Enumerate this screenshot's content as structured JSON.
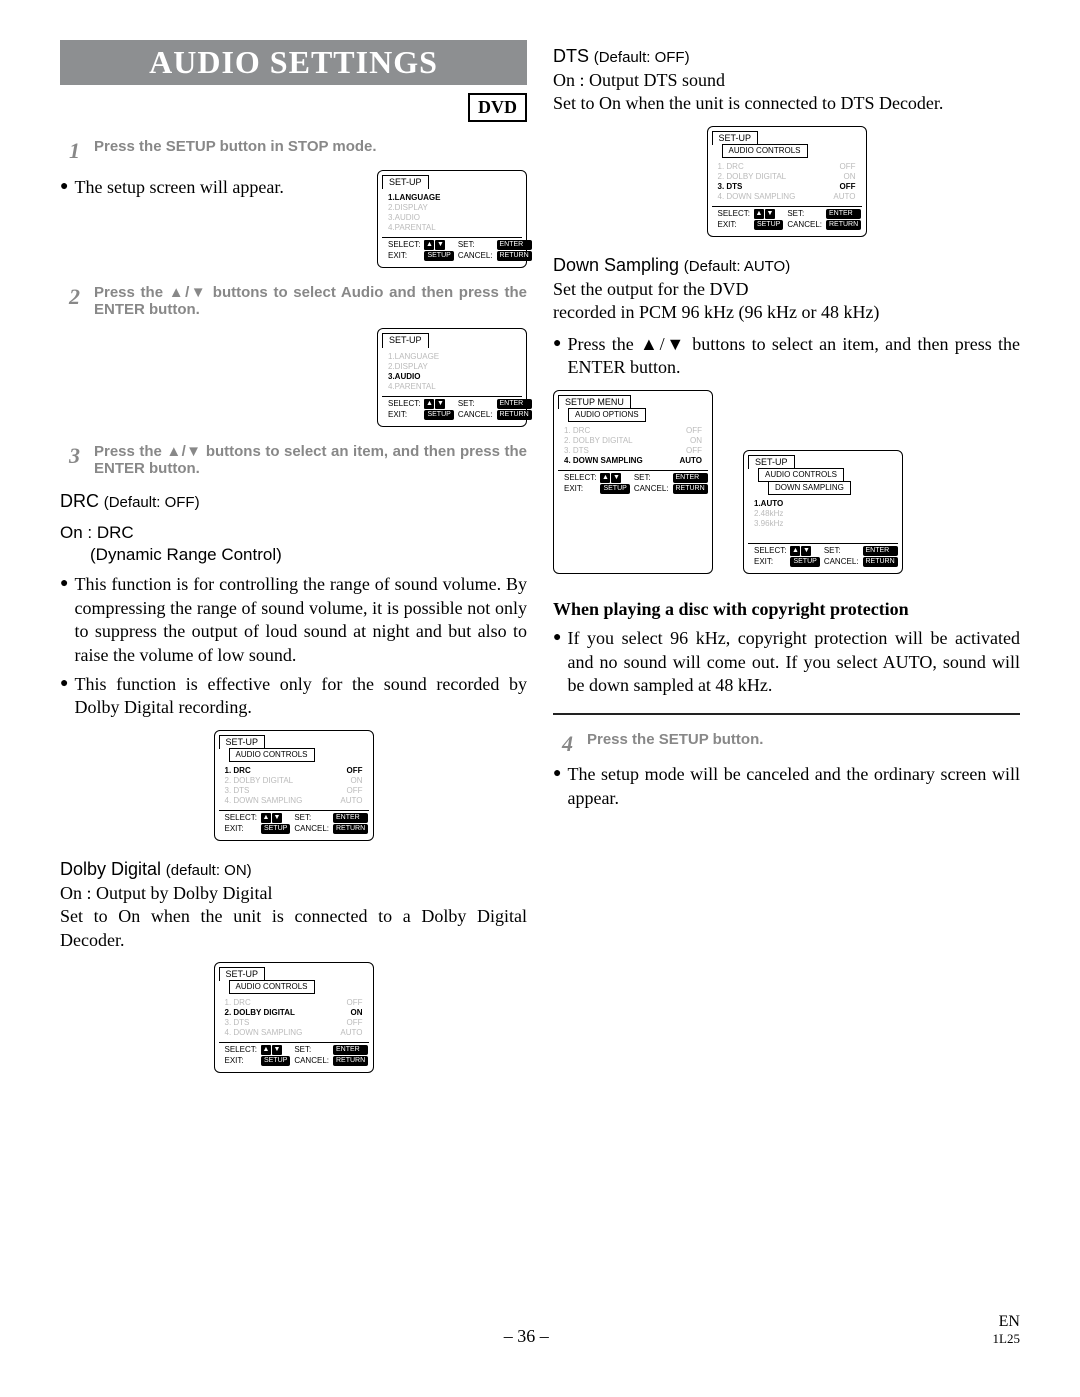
{
  "title": "AUDIO SETTINGS",
  "media_badge": "DVD",
  "steps": {
    "s1": {
      "num": "1",
      "text": "Press the SETUP button in STOP mode."
    },
    "s2": {
      "num": "2",
      "text": "Press the ▲/▼ buttons to select Audio and then press the ENTER button."
    },
    "s3": {
      "num": "3",
      "text": "Press the ▲/▼ buttons to select an item, and then press the ENTER button."
    },
    "s4": {
      "num": "4",
      "text": "Press the SETUP button."
    }
  },
  "text": {
    "setup_appear": "The setup screen will appear.",
    "drc_head": "DRC",
    "drc_default": "(Default: OFF)",
    "drc_on": "On : DRC",
    "drc_sub": "(Dynamic Range Control)",
    "drc_b1": "This function is for controlling the range of sound volume. By compressing the range of sound volume, it is possible not only to suppress the output of loud sound at night and but also to raise the volume of low sound.",
    "drc_b2": "This function is effective only for the sound recorded by Dolby Digital recording.",
    "dolby_head": "Dolby Digital",
    "dolby_default": "(default: ON)",
    "dolby_on": "On : Output by Dolby Digital",
    "dolby_note": "Set to On when the unit is connected to a Dolby Digital Decoder.",
    "dts_head": "DTS",
    "dts_default": "(Default: OFF)",
    "dts_on": "On : Output DTS sound",
    "dts_note": "Set to On when the unit is connected to DTS Decoder.",
    "ds_head": "Down Sampling",
    "ds_default": "(Default: AUTO)",
    "ds_l1": "Set the output for the DVD",
    "ds_l2": "recorded in PCM 96 kHz (96 kHz or 48 kHz)",
    "ds_bullet": "Press the ▲/▼ buttons to select an item, and then press the ENTER button.",
    "copyright_h": "When playing a disc with copyright  protection",
    "copyright_b": "If you select 96 kHz, copyright protection will be activated and no sound will come out. If you select AUTO, sound will be down sampled at 48 kHz.",
    "cancel_b": "The setup mode will be canceled and the ordinary screen will appear."
  },
  "osd": {
    "setup": "SET-UP",
    "setup_menu": "SETUP MENU",
    "audio_controls": "AUDIO CONTROLS",
    "audio_options": "AUDIO OPTIONS",
    "down_sampling": "DOWN SAMPLING",
    "root_items": [
      "1.LANGUAGE",
      "2.DISPLAY",
      "3.AUDIO",
      "4.PARENTAL"
    ],
    "audio_items": [
      {
        "l": "1. DRC",
        "v": "OFF"
      },
      {
        "l": "2. DOLBY DIGITAL",
        "v": "ON"
      },
      {
        "l": "3. DTS",
        "v": "OFF"
      },
      {
        "l": "4. DOWN SAMPLING",
        "v": "AUTO"
      }
    ],
    "ds_items": [
      {
        "l": "1.AUTO"
      },
      {
        "l": "2.48kHz"
      },
      {
        "l": "3.96kHz"
      }
    ],
    "ftr": {
      "select": "SELECT:",
      "set": "SET:",
      "enter": "ENTER",
      "exit": "EXIT:",
      "setupPill": "SETUP",
      "cancel": "CANCEL:",
      "return": "RETURN"
    }
  },
  "footer": {
    "page": "– 36 –",
    "lang": "EN",
    "code": "1L25"
  }
}
